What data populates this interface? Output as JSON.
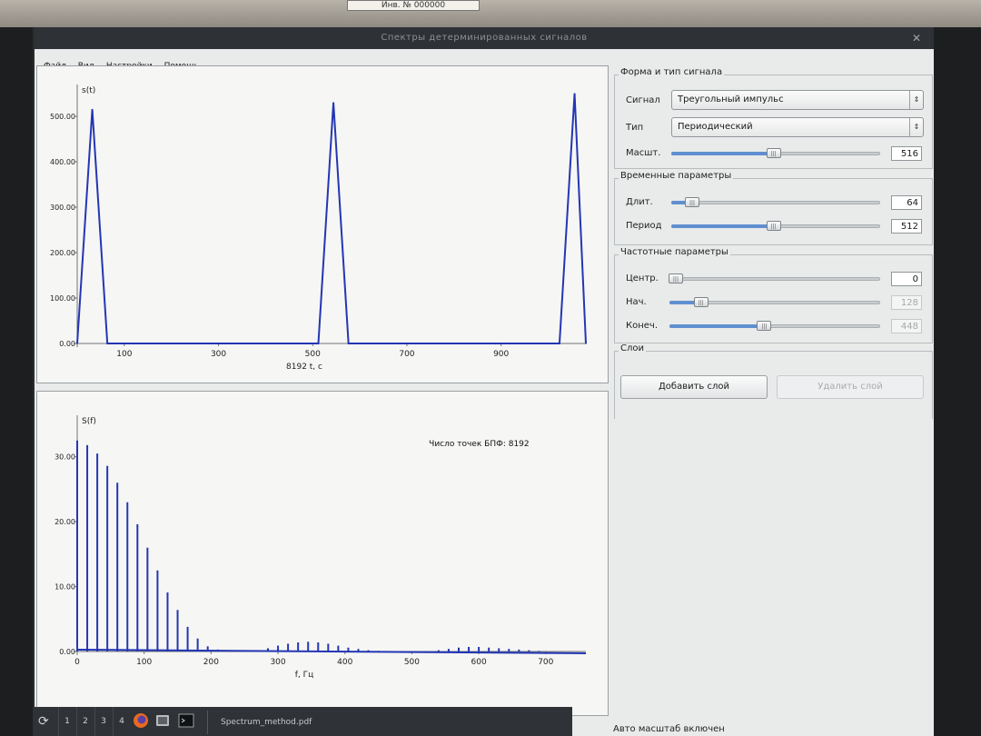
{
  "photo_label": "Инв. № 000000",
  "window": {
    "title": "Спектры детерминированных сигналов",
    "close_glyph": "✕"
  },
  "menu": [
    "Файл",
    "Вид",
    "Настройки",
    "Помощь"
  ],
  "signal_group": {
    "title": "Форма и тип сигнала",
    "signal_label": "Сигнал",
    "signal_value": "Треугольный импульс",
    "type_label": "Тип",
    "type_value": "Периодический",
    "scale_label": "Масшт.",
    "scale_value": "516",
    "scale_fraction": 0.49
  },
  "time_group": {
    "title": "Временные параметры",
    "duration_label": "Длит.",
    "duration_value": "64",
    "duration_fraction": 0.1,
    "period_label": "Период",
    "period_value": "512",
    "period_fraction": 0.49
  },
  "freq_group": {
    "title": "Частотные параметры",
    "center_label": "Центр.",
    "center_value": "0",
    "center_fraction": 0.03,
    "start_label": "Нач.",
    "start_value": "128",
    "start_fraction": 0.15,
    "end_label": "Конеч.",
    "end_value": "448",
    "end_fraction": 0.45
  },
  "layers_group": {
    "title": "Слои",
    "add_label": "Добавить слой",
    "remove_label": "Удалить слой"
  },
  "status": "Авто масштаб включен",
  "taskbar": {
    "workspaces": [
      "1",
      "2",
      "3",
      "4"
    ],
    "task_label": "Spectrum_method.pdf"
  },
  "colors": {
    "series": "#2436b4",
    "panel_bg": "#e9eaea",
    "plot_bg": "#f6f6f4"
  },
  "chart_data": [
    {
      "type": "line",
      "ylabel": "s(t)",
      "xlabel": "8192 t, c",
      "xlim": [
        0,
        1080
      ],
      "ylim": [
        0,
        550
      ],
      "x_ticks": [
        100,
        300,
        500,
        700,
        900
      ],
      "y_ticks": [
        "0.00",
        "100.00",
        "200.00",
        "300.00",
        "400.00",
        "500.00"
      ],
      "y_tick_values": [
        0,
        100,
        200,
        300,
        400,
        500
      ],
      "x": [
        0,
        32,
        64,
        96,
        512,
        544,
        576,
        608,
        1024,
        1056,
        1080
      ],
      "y": [
        0,
        515,
        0,
        0,
        0,
        530,
        0,
        0,
        0,
        550,
        0
      ]
    },
    {
      "type": "bar",
      "ylabel": "S(f)",
      "xlabel": "f, Гц",
      "annotation": "Число точек БПФ: 8192",
      "xlim": [
        0,
        760
      ],
      "ylim": [
        0,
        35
      ],
      "x_ticks": [
        0,
        100,
        200,
        300,
        400,
        500,
        600,
        700
      ],
      "y_ticks": [
        "0.00",
        "10.00",
        "20.00",
        "30.00"
      ],
      "y_tick_values": [
        0,
        10,
        20,
        30
      ],
      "x": [
        0,
        15,
        30,
        45,
        60,
        75,
        90,
        105,
        120,
        135,
        150,
        165,
        180,
        195,
        210,
        225,
        270,
        285,
        300,
        315,
        330,
        345,
        360,
        375,
        390,
        405,
        420,
        435,
        450,
        540,
        555,
        570,
        585,
        600,
        615,
        630,
        645,
        660,
        675,
        690
      ],
      "y": [
        32.5,
        31.8,
        30.5,
        28.6,
        26,
        23,
        19.6,
        16,
        12.5,
        9.1,
        6.4,
        3.8,
        2,
        0.8,
        0.3,
        0.1,
        0.2,
        0.5,
        0.9,
        1.2,
        1.4,
        1.5,
        1.4,
        1.2,
        0.9,
        0.6,
        0.4,
        0.2,
        0.1,
        0.2,
        0.4,
        0.6,
        0.7,
        0.7,
        0.6,
        0.5,
        0.4,
        0.3,
        0.2,
        0.1
      ]
    }
  ]
}
